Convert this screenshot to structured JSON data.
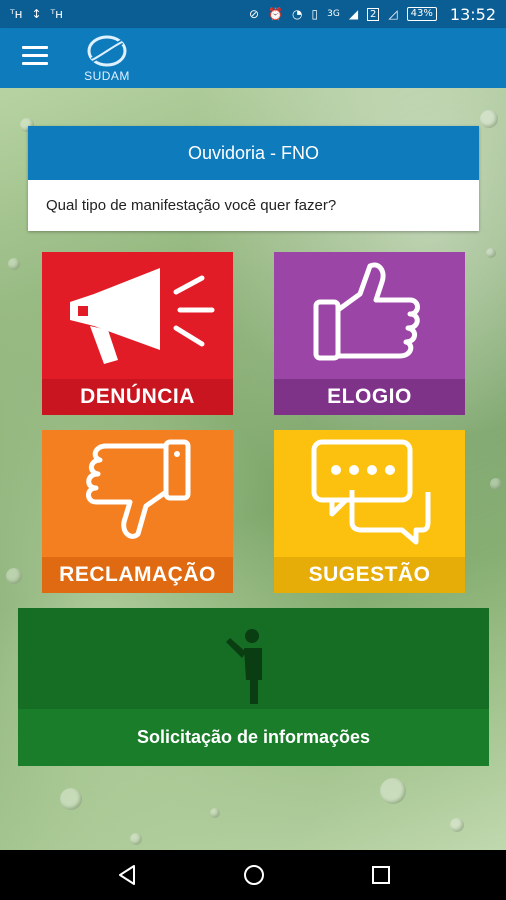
{
  "status_bar": {
    "left_icons": [
      "signal-h-icon",
      "data-transfer-icon",
      "signal-h-icon"
    ],
    "left_glyphs": [
      "ᵀʜ",
      "↕",
      "ᵀʜ"
    ],
    "network": "3G",
    "sim": "2",
    "battery": "43%",
    "time": "13:52"
  },
  "app_bar": {
    "logo_text": "SUDAM"
  },
  "card": {
    "title": "Ouvidoria - FNO",
    "question": "Qual tipo de manifestação você quer fazer?"
  },
  "tiles": {
    "denuncia": "DENÚNCIA",
    "elogio": "ELOGIO",
    "reclamacao": "RECLAMAÇÃO",
    "sugestao": "SUGESTÃO"
  },
  "info": {
    "label": "Solicitação de informações"
  },
  "colors": {
    "appbar": "#0e7bbd",
    "denuncia": "#e21c26",
    "elogio": "#9b46a6",
    "reclamacao": "#f47f20",
    "sugestao": "#fbc10e",
    "info": "#197d2a"
  }
}
